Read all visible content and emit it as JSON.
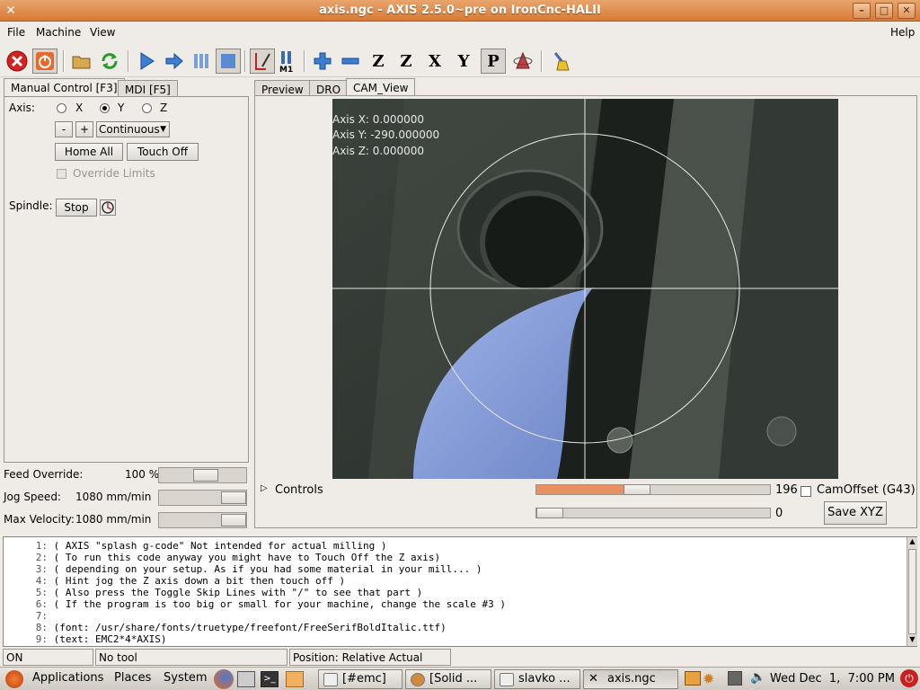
{
  "window": {
    "title": "axis.ngc - AXIS 2.5.0~pre on IronCnc-HALII"
  },
  "menu": {
    "file": "File",
    "machine": "Machine",
    "view": "View",
    "help": "Help"
  },
  "left_tabs": [
    "Manual Control [F3]",
    "MDI [F5]"
  ],
  "manual": {
    "axis_label": "Axis:",
    "axes": [
      "X",
      "Y",
      "Z"
    ],
    "selected_axis": "Y",
    "minus": "-",
    "plus": "+",
    "jog_mode": "Continuous",
    "home_all": "Home All",
    "touch_off": "Touch Off",
    "override_limits": "Override Limits",
    "spindle_label": "Spindle:",
    "spindle_stop": "Stop"
  },
  "overrides": {
    "feed_label": "Feed Override:",
    "feed_value": "100 %",
    "feed_level": 0.55,
    "jog_label": "Jog Speed:",
    "jog_value": "1080 mm/min",
    "jog_level": 1.0,
    "vel_label": "Max Velocity:",
    "vel_value": "1080 mm/min",
    "vel_level": 1.0
  },
  "view_tabs": [
    "Preview",
    "DRO",
    "CAM_View"
  ],
  "cam": {
    "axis_x": "Axis X: 0.000000",
    "axis_y": "Axis Y: -290.000000",
    "axis_z": "Axis Z: 0.000000",
    "controls_label": "Controls",
    "slider1_value": "196",
    "slider1_level": 0.42,
    "slider2_value": "0",
    "slider2_level": 0.0,
    "camoffset_label": "CamOffset (G43)",
    "save_xyz": "Save XYZ"
  },
  "gcode_lines": [
    {
      "n": "1:",
      "t": "( AXIS \"splash g-code\" Not intended for actual milling )"
    },
    {
      "n": "2:",
      "t": "( To run this code anyway you might have to Touch Off the Z axis)"
    },
    {
      "n": "3:",
      "t": "( depending on your setup. As if you had some material in your mill... )"
    },
    {
      "n": "4:",
      "t": "( Hint jog the Z axis down a bit then touch off )"
    },
    {
      "n": "5:",
      "t": "( Also press the Toggle Skip Lines with \"/\" to see that part )"
    },
    {
      "n": "6:",
      "t": "( If the program is too big or small for your machine, change the scale #3 )"
    },
    {
      "n": "7:",
      "t": ""
    },
    {
      "n": "8:",
      "t": "(font: /usr/share/fonts/truetype/freefont/FreeSerifBoldItalic.ttf)"
    },
    {
      "n": "9:",
      "t": "(text: EMC2*4*AXIS)"
    }
  ],
  "status": {
    "state": "ON",
    "tool": "No tool",
    "position": "Position: Relative Actual"
  },
  "panel": {
    "applications": "Applications",
    "places": "Places",
    "system": "System",
    "tasks": [
      "[#emc]",
      "[Solid ...",
      "slavko ...",
      "axis.ngc"
    ],
    "clock": "Wed Dec  1,  7:00 PM"
  }
}
